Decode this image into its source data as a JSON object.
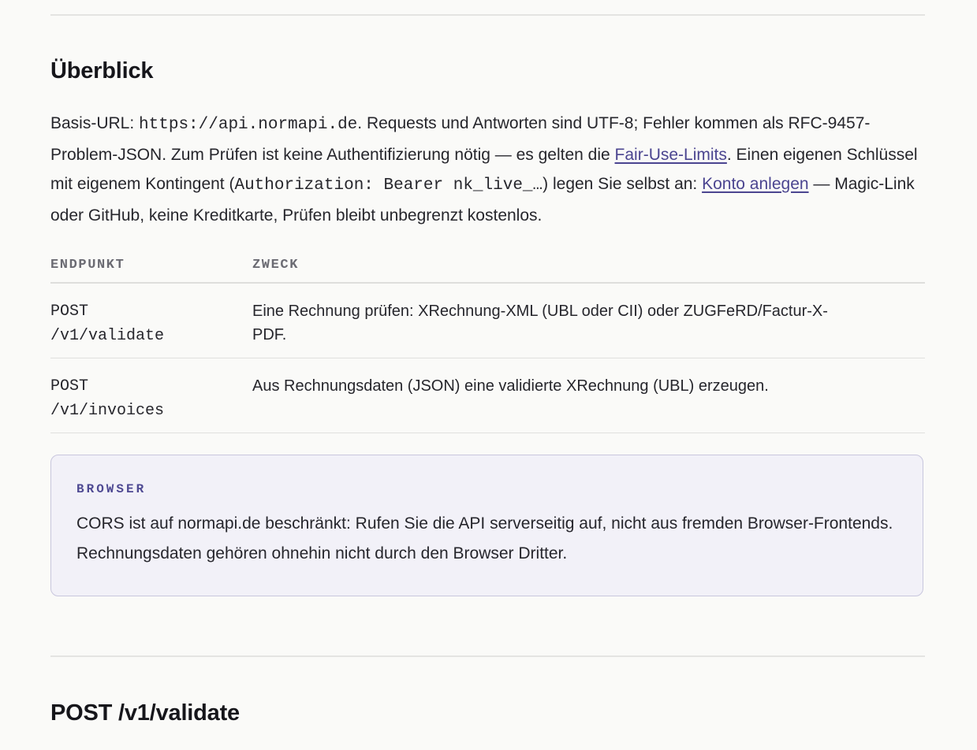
{
  "overview": {
    "heading": "Überblick",
    "intro": {
      "t1": "Basis-URL: ",
      "base_url": "https://api.normapi.de",
      "t2": ". Requests und Antworten sind UTF-8; Fehler kommen als RFC-9457-Problem-JSON. Zum Prüfen ist keine Authentifizierung nötig — es gelten die ",
      "fair_use_link": "Fair-Use-Limits",
      "t3": ". Einen eigenen Schlüssel mit eigenem Kontingent (",
      "auth_header": "Authorization: Bearer nk_live_…",
      "t4": ") legen Sie selbst an: ",
      "signup_link": "Konto anlegen",
      "t5": " — Magic-Link oder GitHub, keine Kreditkarte, Prüfen bleibt unbegrenzt kostenlos."
    }
  },
  "endpoints_table": {
    "headers": [
      "ENDPUNKT",
      "ZWECK"
    ],
    "rows": [
      {
        "method": "POST",
        "path": "/v1/validate",
        "purpose": "Eine Rechnung prüfen: XRechnung-XML (UBL oder CII) oder ZUGFeRD/Factur-X-PDF."
      },
      {
        "method": "POST",
        "path": "/v1/invoices",
        "purpose": "Aus Rechnungsdaten (JSON) eine validierte XRechnung (UBL) erzeugen."
      }
    ]
  },
  "browser_note": {
    "tag": "BROWSER",
    "text": "CORS ist auf normapi.de beschränkt: Rufen Sie die API serverseitig auf, nicht aus fremden Browser-Frontends. Rechnungsdaten gehören ohnehin nicht durch den Browser Dritter."
  },
  "validate_section": {
    "heading": "POST /v1/validate"
  },
  "colors": {
    "background": "#fafaf8",
    "link": "#4b4590",
    "callout_bg": "#f2f1f8",
    "callout_border": "#c8c6dd",
    "callout_tag": "#4f4a93"
  }
}
